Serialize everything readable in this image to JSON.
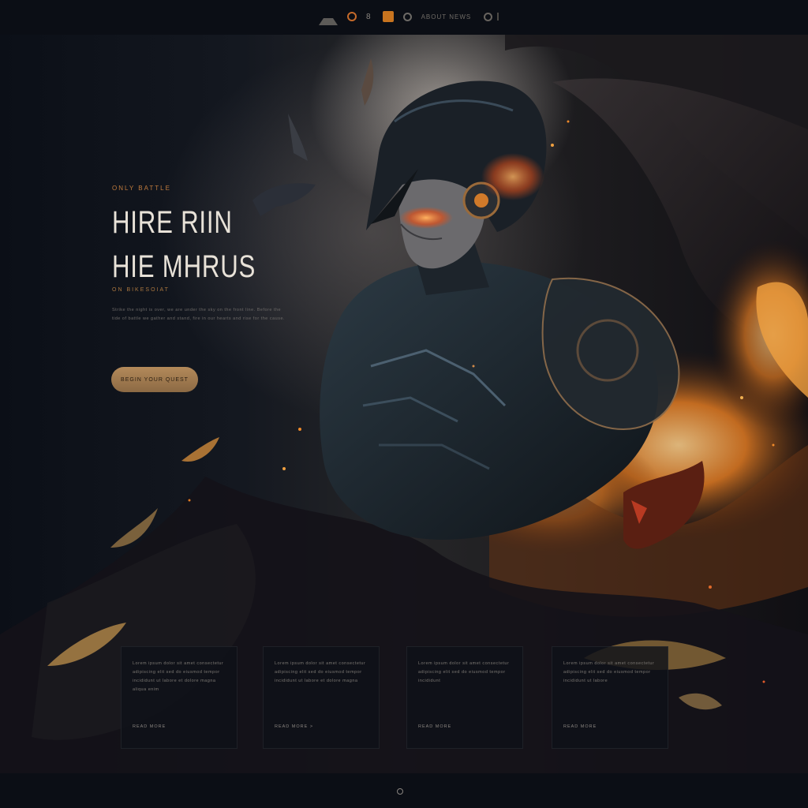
{
  "nav": {
    "item_1": "8",
    "menu_text": "ABOUT NEWS"
  },
  "hero": {
    "eyebrow": "ONLY BATTLE",
    "title_line1": "HIRE RIIN",
    "title_line2": "HIE MHRUS",
    "subline": "ON BIKESOIAT",
    "body": "Strike the night is over, we are under the sky on the front line. Before the tide of battle we gather and stand, fire in our hearts and rise for the cause.",
    "cta_label": "BEGIN YOUR QUEST"
  },
  "cards": [
    {
      "text": "Lorem ipsum dolor sit amet consectetur adipiscing elit sed do eiusmod tempor incididunt ut labore et dolore magna aliqua enim",
      "link": "READ MORE"
    },
    {
      "text": "Lorem ipsum dolor sit amet consectetur adipiscing elit sed do eiusmod tempor incididunt ut labore et dolore magna",
      "link": "READ MORE >"
    },
    {
      "text": "Lorem ipsum dolor sit amet consectetur adipiscing elit sed do eiusmod tempor incididunt",
      "link": "READ MORE"
    },
    {
      "text": "Lorem ipsum dolor sit amet consectetur adipiscing elit sed do eiusmod tempor incididunt ut labore",
      "link": "READ MORE"
    }
  ],
  "colors": {
    "accent": "#c8741f",
    "background": "#0a0d14",
    "cta": "#b38a5a"
  }
}
